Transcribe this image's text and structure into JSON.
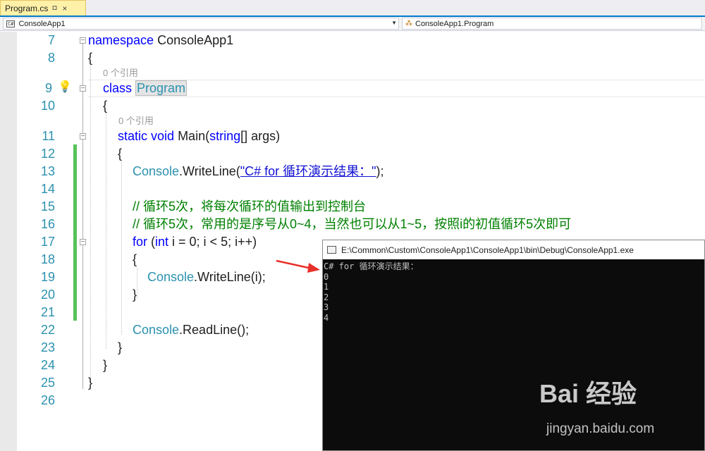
{
  "tab": {
    "filename": "Program.cs",
    "pin_icon": "pin-icon",
    "close_icon": "close-icon"
  },
  "navbar": {
    "project": "ConsoleApp1",
    "project_badge": "C#",
    "member": "ConsoleApp1.Program"
  },
  "editor": {
    "references": "0 个引用",
    "lines": [
      {
        "num": "7"
      },
      {
        "num": "8"
      },
      {
        "num": "9"
      },
      {
        "num": "10"
      },
      {
        "num": "11"
      },
      {
        "num": "12"
      },
      {
        "num": "13"
      },
      {
        "num": "14"
      },
      {
        "num": "15"
      },
      {
        "num": "16"
      },
      {
        "num": "17"
      },
      {
        "num": "18"
      },
      {
        "num": "19"
      },
      {
        "num": "20"
      },
      {
        "num": "21"
      },
      {
        "num": "22"
      },
      {
        "num": "23"
      },
      {
        "num": "24"
      },
      {
        "num": "25"
      },
      {
        "num": "26"
      }
    ],
    "code": {
      "l7_kw": "namespace",
      "l7_name": " ConsoleApp1",
      "l8": "{",
      "l9_kw": "class",
      "l9_name": "Program",
      "l10": "{",
      "l11_kw1": "static",
      "l11_kw2": "void",
      "l11_main": " Main(",
      "l11_kw3": "string",
      "l11_rest": "[] args)",
      "l12": "{",
      "l13_type": "Console",
      "l13_method": ".WriteLine(",
      "l13_str": "\"C# for 循环演示结果：\"",
      "l13_end": ");",
      "l15_comment": "// 循环5次，将每次循环的值输出到控制台",
      "l16_comment": "// 循环5次，常用的是序号从0~4，当然也可以从1~5，按照i的初值循环5次即可",
      "l17_kw": "for",
      "l17_p1": " (",
      "l17_kw2": "int",
      "l17_rest": " i = 0; i < 5; i++)",
      "l18": "{",
      "l19_type": "Console",
      "l19_rest": ".WriteLine(i);",
      "l20": "}",
      "l22_type": "Console",
      "l22_rest": ".ReadLine();",
      "l23": "}",
      "l24": "}",
      "l25": "}"
    }
  },
  "console": {
    "title": "E:\\Common\\Custom\\ConsoleApp1\\ConsoleApp1\\bin\\Debug\\ConsoleApp1.exe",
    "output": [
      "C# for 循环演示结果：",
      "0",
      "1",
      "2",
      "3",
      "4"
    ]
  },
  "watermark": {
    "logo": "Bai 经验",
    "url": "jingyan.baidu.com"
  }
}
